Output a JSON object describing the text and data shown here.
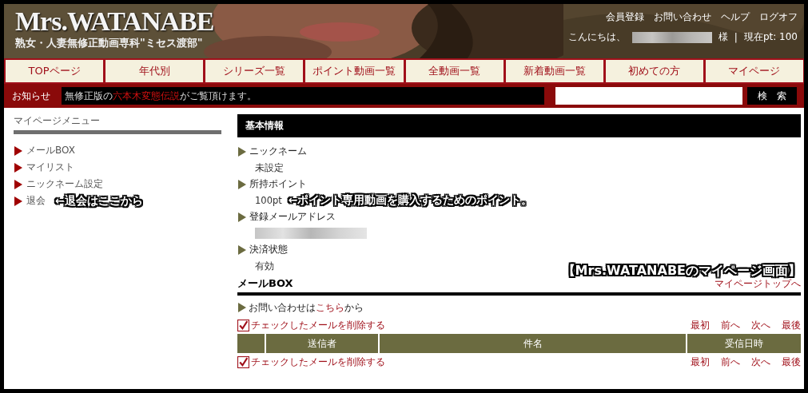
{
  "header": {
    "logo": "Mrs.WATANABE",
    "tagline": "熟女・人妻無修正動画専科\"ミセス渡部\"",
    "links": [
      "会員登録",
      "お問い合わせ",
      "ヘルプ",
      "ログオフ"
    ],
    "greeting": {
      "prefix": "こんにちは、",
      "redacted": true,
      "suffix": "様"
    },
    "separator": "|",
    "points": "現在pt: 100"
  },
  "nav": [
    {
      "label": "TOPページ",
      "selected": false
    },
    {
      "label": "年代別",
      "selected": false
    },
    {
      "label": "シリーズ一覧",
      "selected": false
    },
    {
      "label": "ポイント動画一覧",
      "selected": false
    },
    {
      "label": "全動画一覧",
      "selected": false
    },
    {
      "label": "新着動画一覧",
      "selected": false
    },
    {
      "label": "初めての方",
      "selected": false
    },
    {
      "label": "マイページ",
      "selected": false
    }
  ],
  "notice": {
    "label": "お知らせ",
    "text": "無修正版の**六本木変態伝説**がご覧頂けます。",
    "search_button": "検　索"
  },
  "sidebar": {
    "title": "マイページメニュー",
    "items": [
      {
        "label": "メールBOX"
      },
      {
        "label": "マイリスト"
      },
      {
        "label": "ニックネーム設定"
      },
      {
        "label": "退会",
        "annotation": "←退会はここから"
      }
    ]
  },
  "basic_info": {
    "title": "基本情報",
    "items": [
      {
        "label": "ニックネーム",
        "kind": "value",
        "value": "未設定"
      },
      {
        "label": "所持ポイント",
        "kind": "value",
        "value": "100pt",
        "annotation": "←ポイント専用動画を購入するためのポイント。"
      },
      {
        "label": "登録メールアドレス",
        "kind": "redacted"
      },
      {
        "label": "決済状態",
        "kind": "value",
        "value": "有効"
      }
    ]
  },
  "caption": "【Mrs.WATANABEのマイページ画面】",
  "mailbox": {
    "title": "メールBOX",
    "top_link": "マイページトップへ",
    "contact_prefix": "お問い合わせは",
    "contact_link": "こちら",
    "contact_suffix": "から",
    "action_rows": [
      {
        "delete_link": "チェックしたメールを削除する",
        "pager": [
          "最初",
          "前へ",
          "次へ",
          "最後"
        ]
      },
      {
        "delete_link": "チェックしたメールを削除する",
        "pager": [
          "最初",
          "前へ",
          "次へ",
          "最後"
        ]
      }
    ],
    "columns": [
      "送信者",
      "件名",
      "受信日時"
    ]
  }
}
